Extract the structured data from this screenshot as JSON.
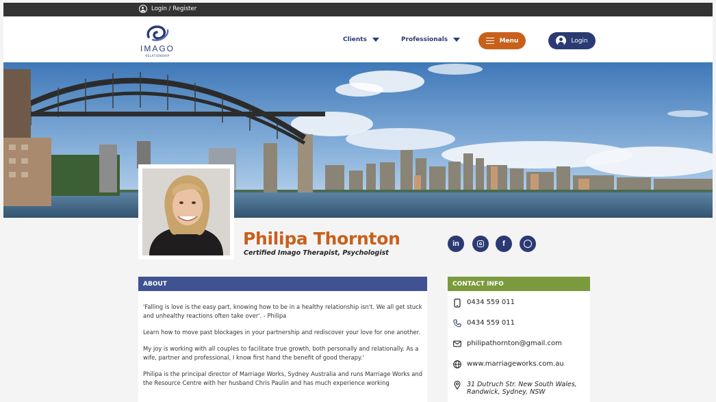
{
  "topbar": {
    "login_register": "Login / Register"
  },
  "header": {
    "logo_word": "IMAGO",
    "logo_sub": "RELATIONSHIP",
    "nav": {
      "clients": "Clients",
      "professionals": "Professionals"
    },
    "menu_label": "Menu",
    "login_label": "Login"
  },
  "colors": {
    "brand_navy": "#2b3a73",
    "brand_orange": "#c8601b",
    "about_blue": "#3f5393",
    "contact_green": "#7a9a3d"
  },
  "profile": {
    "name": "Philipa Thornton",
    "title": "Certified Imago Therapist, Psychologist"
  },
  "social": [
    "linkedin-icon",
    "instagram-icon",
    "facebook-icon",
    "whatsapp-icon"
  ],
  "about": {
    "heading": "ABOUT",
    "paragraphs": [
      "'Falling is love is the easy part, knowing how to be in a healthy relationship isn't. We all get stuck and unhealthy reactions often take over'.  - Philipa",
      "Learn how to move past blockages in your partnership and rediscover your love for one another.",
      "My joy is working with all couples to facilitate true growth, both personally and relationally. As a wife, partner and professional, I know first hand the benefit of good therapy.'",
      "Philipa is the principal  director of  Marriage Works, Sydney Australia and runs Marriage Works and the Resource Centre with her husband Chris Paulin and has much experience working"
    ]
  },
  "contact": {
    "heading": "CONTACT INFO",
    "mobile": "0434 559 011",
    "phone": "0434 559 011",
    "email": "philipathornton@gmail.com",
    "website": "www.marriageworks.com.au",
    "address": "31 Dutruch Str. New South Wales, Randwick, Sydney, NSW"
  }
}
